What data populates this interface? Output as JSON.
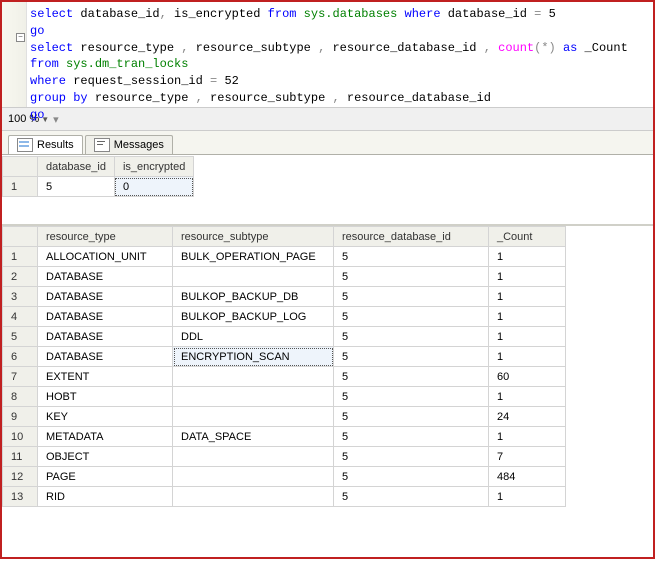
{
  "editor": {
    "lines": [
      {
        "tokens": [
          {
            "t": "kw",
            "v": "select"
          },
          {
            "t": "ident",
            "v": " database_id"
          },
          {
            "t": "op",
            "v": ","
          },
          {
            "t": "ident",
            "v": " is_encrypted "
          },
          {
            "t": "kw",
            "v": "from"
          },
          {
            "t": "sys",
            "v": " sys.databases "
          },
          {
            "t": "kw",
            "v": "where"
          },
          {
            "t": "ident",
            "v": " database_id "
          },
          {
            "t": "op",
            "v": "= "
          },
          {
            "t": "num",
            "v": "5"
          }
        ]
      },
      {
        "tokens": [
          {
            "t": "kw",
            "v": "go"
          }
        ]
      },
      {
        "tokens": [
          {
            "t": "kw",
            "v": "select"
          },
          {
            "t": "ident",
            "v": " resource_type "
          },
          {
            "t": "op",
            "v": ","
          },
          {
            "t": "ident",
            "v": " resource_subtype "
          },
          {
            "t": "op",
            "v": ","
          },
          {
            "t": "ident",
            "v": " resource_database_id "
          },
          {
            "t": "op",
            "v": ","
          },
          {
            "t": "ident",
            "v": " "
          },
          {
            "t": "func",
            "v": "count"
          },
          {
            "t": "op",
            "v": "("
          },
          {
            "t": "op",
            "v": "*"
          },
          {
            "t": "op",
            "v": ")"
          },
          {
            "t": "ident",
            "v": " "
          },
          {
            "t": "kw",
            "v": "as"
          },
          {
            "t": "ident",
            "v": " _Count"
          }
        ]
      },
      {
        "tokens": [
          {
            "t": "kw",
            "v": "from"
          },
          {
            "t": "sys",
            "v": " sys.dm_tran_locks"
          }
        ]
      },
      {
        "tokens": [
          {
            "t": "kw",
            "v": "where"
          },
          {
            "t": "ident",
            "v": " request_session_id "
          },
          {
            "t": "op",
            "v": "= "
          },
          {
            "t": "num",
            "v": "52"
          }
        ]
      },
      {
        "tokens": [
          {
            "t": "kw",
            "v": "group"
          },
          {
            "t": "ident",
            "v": " "
          },
          {
            "t": "kw",
            "v": "by"
          },
          {
            "t": "ident",
            "v": " resource_type "
          },
          {
            "t": "op",
            "v": ","
          },
          {
            "t": "ident",
            "v": " resource_subtype "
          },
          {
            "t": "op",
            "v": ","
          },
          {
            "t": "ident",
            "v": " resource_database_id"
          }
        ]
      },
      {
        "tokens": [
          {
            "t": "kw",
            "v": "go"
          }
        ]
      }
    ]
  },
  "zoom": {
    "level": "100 %"
  },
  "tabs": {
    "results": "Results",
    "messages": "Messages"
  },
  "grid1": {
    "headers": [
      "database_id",
      "is_encrypted"
    ],
    "rows": [
      {
        "n": "1",
        "cells": [
          "5",
          "0"
        ],
        "selected_col": 1
      }
    ]
  },
  "grid2": {
    "headers": [
      "resource_type",
      "resource_subtype",
      "resource_database_id",
      "_Count"
    ],
    "col_widths": [
      "118px",
      "144px",
      "138px",
      "60px"
    ],
    "rows": [
      {
        "n": "1",
        "cells": [
          "ALLOCATION_UNIT",
          "BULK_OPERATION_PAGE",
          "5",
          "1"
        ]
      },
      {
        "n": "2",
        "cells": [
          "DATABASE",
          "",
          "5",
          "1"
        ]
      },
      {
        "n": "3",
        "cells": [
          "DATABASE",
          "BULKOP_BACKUP_DB",
          "5",
          "1"
        ]
      },
      {
        "n": "4",
        "cells": [
          "DATABASE",
          "BULKOP_BACKUP_LOG",
          "5",
          "1"
        ]
      },
      {
        "n": "5",
        "cells": [
          "DATABASE",
          "DDL",
          "5",
          "1"
        ]
      },
      {
        "n": "6",
        "cells": [
          "DATABASE",
          "ENCRYPTION_SCAN",
          "5",
          "1"
        ],
        "selected_col": 1
      },
      {
        "n": "7",
        "cells": [
          "EXTENT",
          "",
          "5",
          "60"
        ]
      },
      {
        "n": "8",
        "cells": [
          "HOBT",
          "",
          "5",
          "1"
        ]
      },
      {
        "n": "9",
        "cells": [
          "KEY",
          "",
          "5",
          "24"
        ]
      },
      {
        "n": "10",
        "cells": [
          "METADATA",
          "DATA_SPACE",
          "5",
          "1"
        ]
      },
      {
        "n": "11",
        "cells": [
          "OBJECT",
          "",
          "5",
          "7"
        ]
      },
      {
        "n": "12",
        "cells": [
          "PAGE",
          "",
          "5",
          "484"
        ]
      },
      {
        "n": "13",
        "cells": [
          "RID",
          "",
          "5",
          "1"
        ]
      }
    ]
  }
}
